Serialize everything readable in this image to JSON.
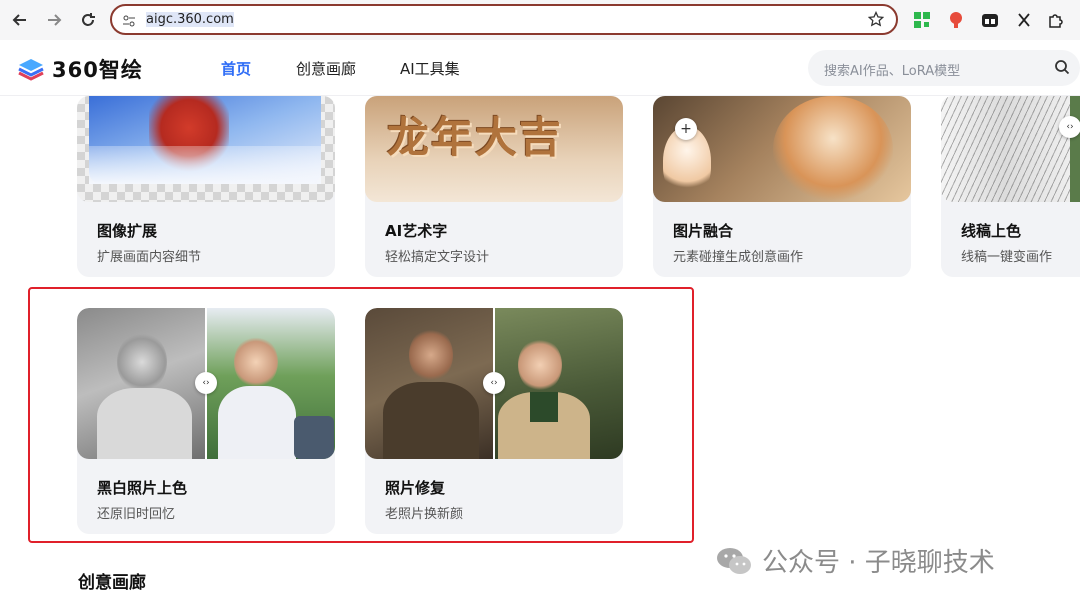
{
  "browser": {
    "url": "aigc.360.com",
    "nav_icons": [
      "back-arrow-icon",
      "forward-arrow-icon",
      "reload-icon"
    ]
  },
  "header": {
    "logo_text": "360智绘",
    "nav": [
      "首页",
      "创意画廊",
      "AI工具集"
    ],
    "search_placeholder": "搜索AI作品、LoRA模型"
  },
  "tools_row1": [
    {
      "title": "图像扩展",
      "desc": "扩展画面内容细节"
    },
    {
      "title": "AI艺术字",
      "desc": "轻松搞定文字设计"
    },
    {
      "title": "图片融合",
      "desc": "元素碰撞生成创意画作"
    },
    {
      "title": "线稿上色",
      "desc": "线稿一键变画作"
    }
  ],
  "tools_row2": [
    {
      "title": "黑白照片上色",
      "desc": "还原旧时回忆"
    },
    {
      "title": "照片修复",
      "desc": "老照片换新颜"
    }
  ],
  "ai_art_text": "龙年大吉",
  "section": {
    "title": "创意画廊"
  },
  "watermark": "公众号 · 子晓聊技术"
}
